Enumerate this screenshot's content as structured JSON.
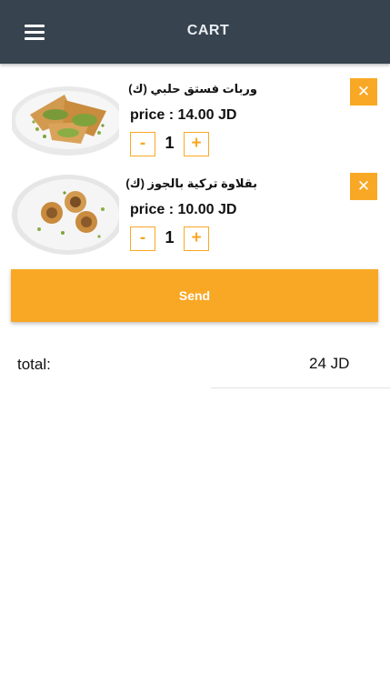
{
  "header": {
    "title": "CART",
    "menu_icon": "hamburger-menu-icon"
  },
  "cart": {
    "items": [
      {
        "name": "وربات فستق حلبي (ك)",
        "price_label": "price : 14.00 JD",
        "quantity": "1",
        "minus_label": "-",
        "plus_label": "+",
        "remove_label": "✕",
        "image": "pistachio-pastries-plate"
      },
      {
        "name": "بقلاوة تركية بالجوز (ك)",
        "price_label": "price : 10.00 JD",
        "quantity": "1",
        "minus_label": "-",
        "plus_label": "+",
        "remove_label": "✕",
        "image": "walnut-baklava-plate"
      }
    ]
  },
  "actions": {
    "send_label": "Send"
  },
  "totals": {
    "label": "total:",
    "value": "24 JD"
  },
  "colors": {
    "header_bg": "#37434f",
    "accent": "#f9a825",
    "text": "#111111"
  }
}
